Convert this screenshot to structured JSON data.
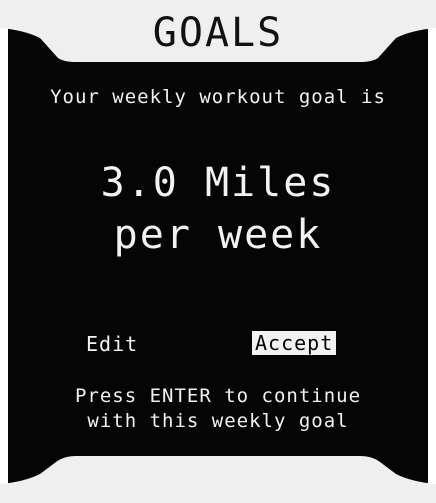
{
  "header": {
    "title": "GOALS"
  },
  "main": {
    "subtitle": "Your weekly workout goal is",
    "goal_line1": "3.0 Miles",
    "goal_line2": "per week"
  },
  "options": {
    "edit_label": "Edit",
    "accept_label": "Accept",
    "selected": "Accept"
  },
  "footer": {
    "instruction_line1": "Press ENTER to continue",
    "instruction_line2": "with this weekly goal"
  }
}
